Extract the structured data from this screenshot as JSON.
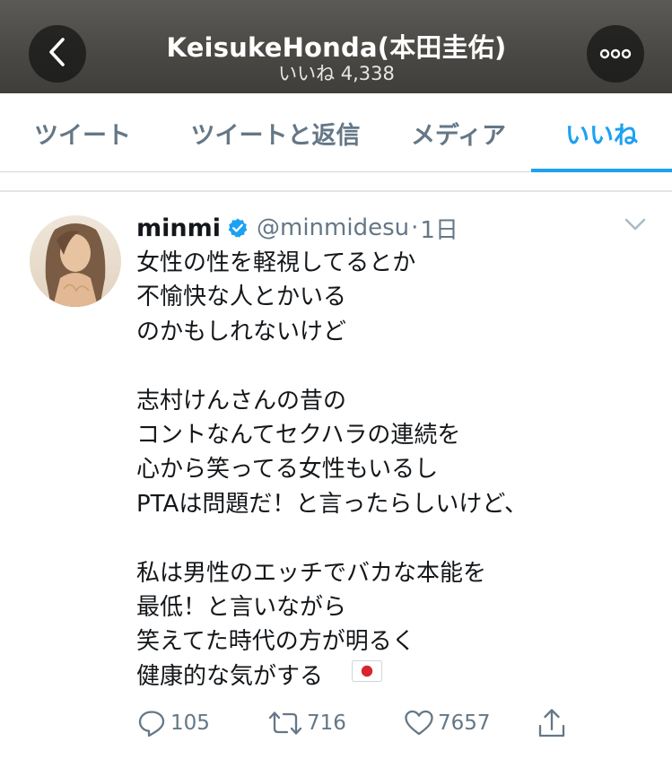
{
  "header": {
    "title": "KeisukeHonda(本田圭佑)",
    "subtitle": "いいね 4,338",
    "back_icon": "chevron-left-icon",
    "more_icon": "more-horizontal-icon"
  },
  "tabs": [
    {
      "label": "ツイート",
      "active": false
    },
    {
      "label": "ツイートと返信",
      "active": false
    },
    {
      "label": "メディア",
      "active": false
    },
    {
      "label": "いいね",
      "active": true
    }
  ],
  "tweet": {
    "user_name": "minmi",
    "verified": true,
    "handle": "@minmidesu",
    "separator": "·",
    "time": "1日",
    "lines": [
      "女性の性を軽視してるとか",
      "不愉快な人とかいる",
      "のかもしれないけど",
      "",
      "志村けんさんの昔の",
      "コントなんてセクハラの連続を",
      "心から笑ってる女性もいるし",
      "PTAは問題だ！と言ったらしいけど、",
      "",
      "私は男性のエッチでバカな本能を",
      "最低！と言いながら",
      "笑えてた時代の方が明るく",
      "健康的な気がする"
    ],
    "emoji": "japan-flag-icon",
    "actions": {
      "reply_count": "105",
      "retweet_count": "716",
      "like_count": "7657"
    }
  },
  "colors": {
    "accent": "#1da1f2",
    "secondary_text": "#657786",
    "primary_text": "#14171a"
  }
}
